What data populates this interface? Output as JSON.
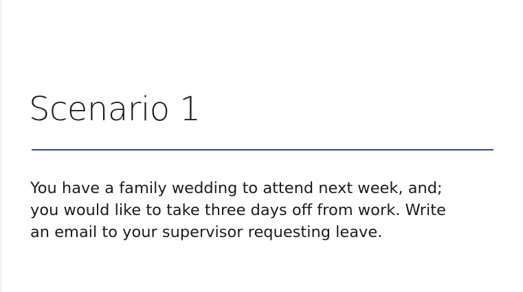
{
  "slide": {
    "title": "Scenario 1",
    "body_lines": [
      "You have a family wedding to attend next week, and;",
      "you would like to take three days off from work. Write",
      "an email to your supervisor requesting leave."
    ],
    "accent_color": "#2e4a8c"
  }
}
